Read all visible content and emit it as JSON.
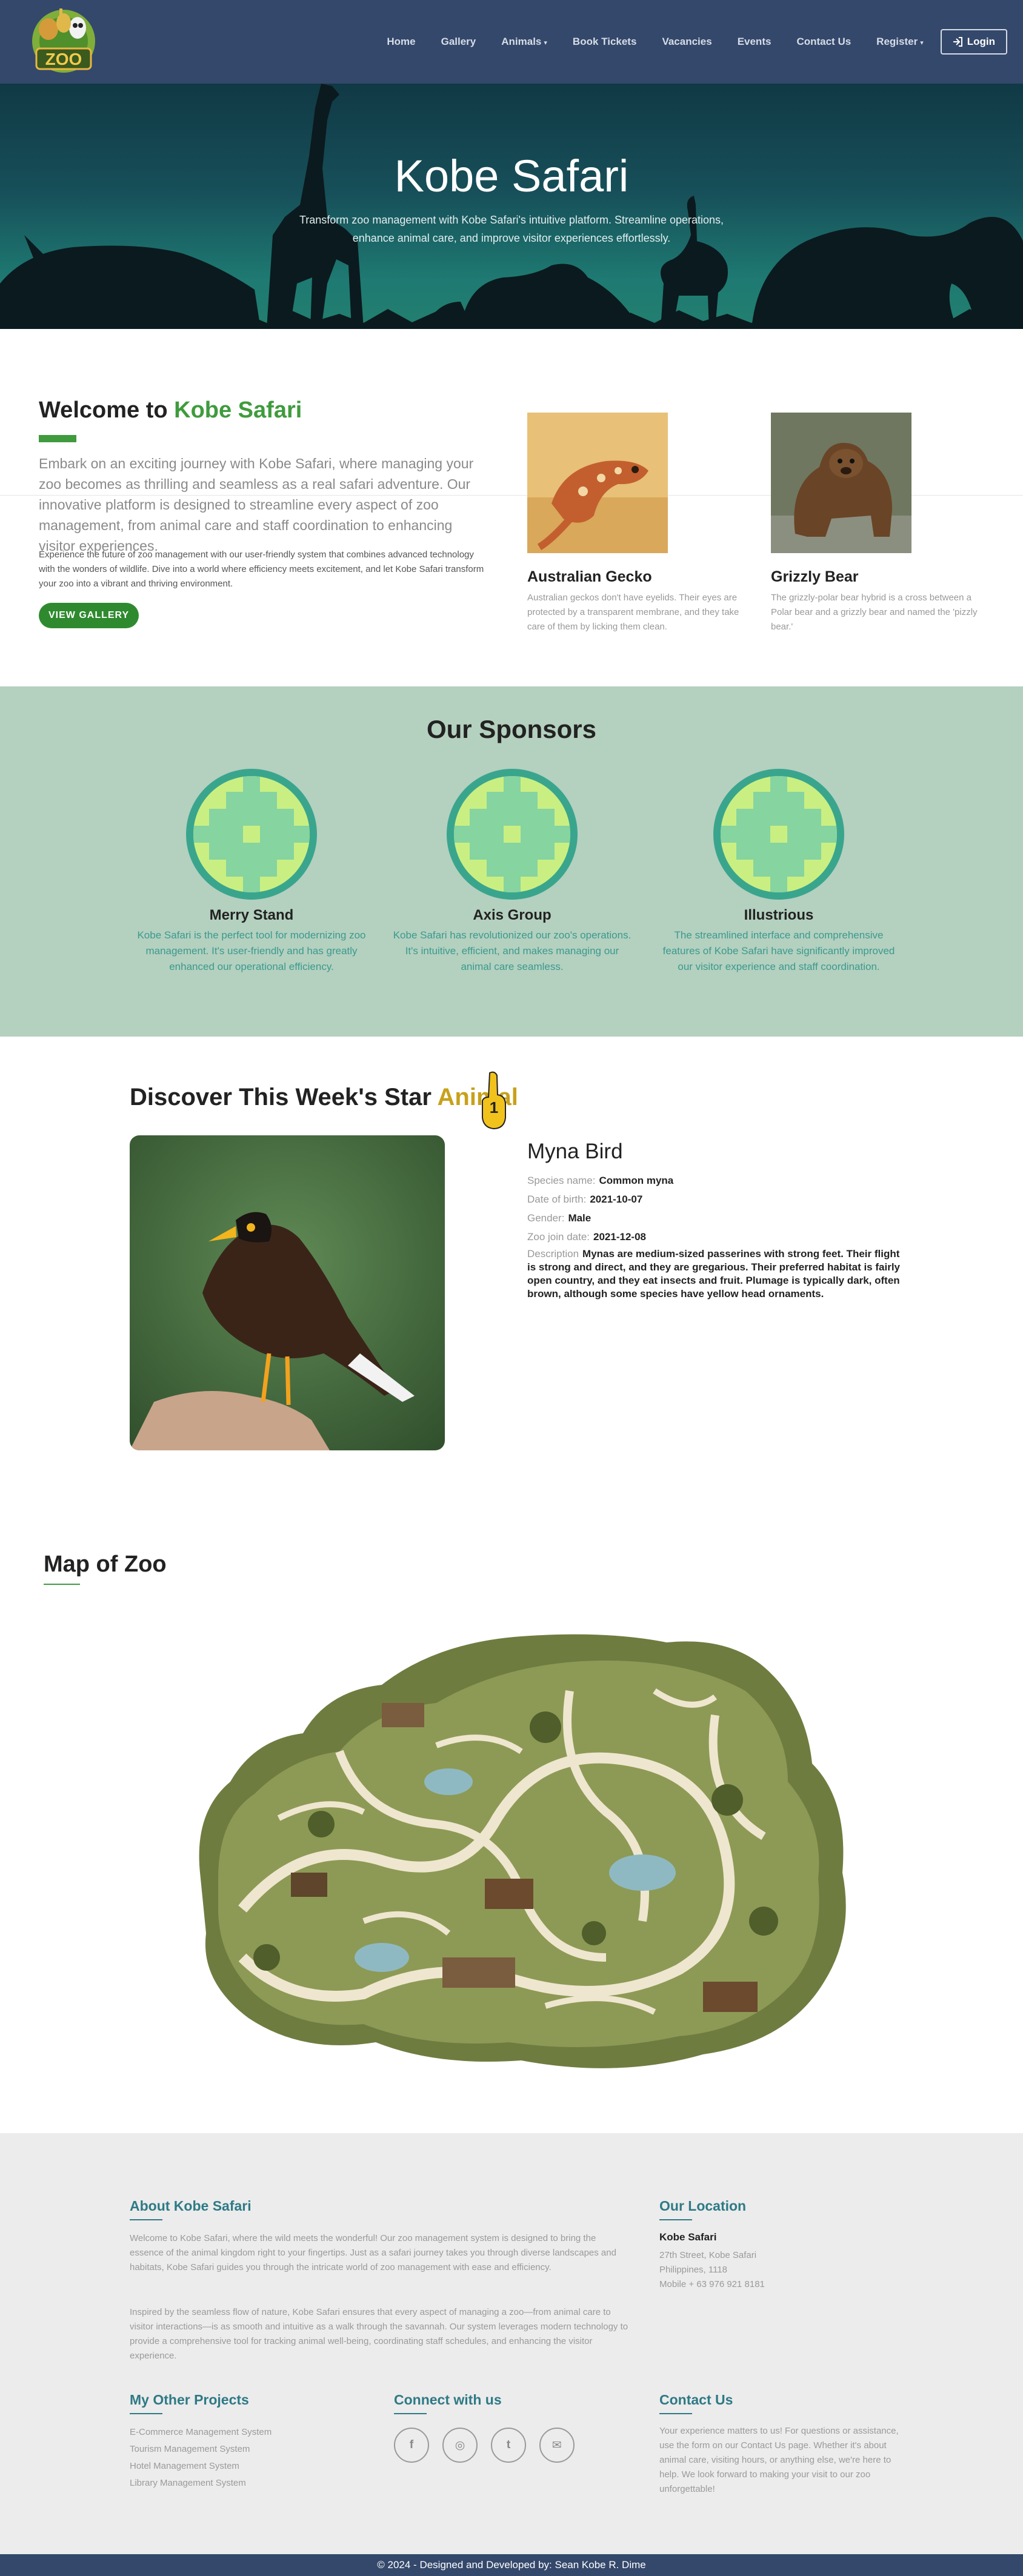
{
  "nav": {
    "logo_text": "ZOO",
    "links": [
      "Home",
      "Gallery",
      "Animals",
      "Book Tickets",
      "Vacancies",
      "Events",
      "Contact Us",
      "Register"
    ],
    "login": "Login"
  },
  "hero": {
    "title": "Kobe Safari",
    "subtitle": "Transform zoo management with Kobe Safari's intuitive platform. Streamline operations, enhance animal care, and improve visitor experiences effortlessly."
  },
  "welcome": {
    "title_prefix": "Welcome to ",
    "title_accent": "Kobe Safari",
    "lead": "Embark on an exciting journey with Kobe Safari, where managing your zoo becomes as thrilling and seamless as a real safari adventure. Our innovative platform is designed to streamline every aspect of zoo management, from animal care and staff coordination to enhancing visitor experiences.",
    "body": "Experience the future of zoo management with our user-friendly system that combines advanced technology with the wonders of wildlife. Dive into a world where efficiency meets excitement, and let Kobe Safari transform your zoo into a vibrant and thriving environment.",
    "button": "VIEW GALLERY",
    "animals": [
      {
        "name": "Australian Gecko",
        "desc": "Australian geckos don't have eyelids. Their eyes are protected by a transparent membrane, and they take care of them by licking them clean."
      },
      {
        "name": "Grizzly Bear",
        "desc": "The grizzly-polar bear hybrid is a cross between a Polar bear and a grizzly bear and named the 'pizzly bear.'"
      }
    ]
  },
  "sponsors": {
    "title": "Our Sponsors",
    "items": [
      {
        "name": "Merry Stand",
        "desc": "Kobe Safari is the perfect tool for modernizing zoo management. It's user-friendly and has greatly enhanced our operational efficiency."
      },
      {
        "name": "Axis Group",
        "desc": "Kobe Safari has revolutionized our zoo's operations. It's intuitive, efficient, and makes managing our animal care seamless."
      },
      {
        "name": "Illustrious",
        "desc": "The streamlined interface and comprehensive features of Kobe Safari have significantly improved our visitor experience and staff coordination."
      }
    ],
    "colors": {
      "ring": "#3aa58d",
      "light": "#c9ef82",
      "mid": "#86d4a0"
    }
  },
  "star": {
    "title_prefix": "Discover This Week's Star ",
    "title_accent": "Animal",
    "hand_label": "1",
    "name": "Myna Bird",
    "fields": [
      {
        "label": "Species name:",
        "value": "Common myna"
      },
      {
        "label": "Date of birth:",
        "value": "2021-10-07"
      },
      {
        "label": "Gender:",
        "value": "Male"
      },
      {
        "label": "Zoo join date:",
        "value": "2021-12-08"
      }
    ],
    "description_label": "Description",
    "description": "Mynas are medium-sized passerines with strong feet. Their flight is strong and direct, and they are gregarious. Their preferred habitat is fairly open country, and they eat insects and fruit. Plumage is typically dark, often brown, although some species have yellow head ornaments."
  },
  "map": {
    "title": "Map of Zoo"
  },
  "footer": {
    "about_title": "About Kobe Safari",
    "about_p1": "Welcome to Kobe Safari, where the wild meets the wonderful! Our zoo management system is designed to bring the essence of the animal kingdom right to your fingertips. Just as a safari journey takes you through diverse landscapes and habitats, Kobe Safari guides you through the intricate world of zoo management with ease and efficiency.",
    "about_p2": "Inspired by the seamless flow of nature, Kobe Safari ensures that every aspect of managing a zoo—from animal care to visitor interactions—is as smooth and intuitive as a walk through the savannah. Our system leverages modern technology to provide a comprehensive tool for tracking animal well-being, coordinating staff schedules, and enhancing the visitor experience.",
    "location_title": "Our Location",
    "location_name": "Kobe Safari",
    "location_lines": [
      "27th Street, Kobe Safari",
      "Philippines, 1118",
      "Mobile + 63 976 921 8181"
    ],
    "projects_title": "My Other Projects",
    "projects": [
      "E-Commerce Management System",
      "Tourism Management System",
      "Hotel Management System",
      "Library Management System"
    ],
    "connect_title": "Connect with us",
    "socials": [
      "f",
      "◎",
      "t",
      "✉"
    ],
    "contact_title": "Contact Us",
    "contact_text": "Your experience matters to us! For questions or assistance, use the form on our Contact Us page. Whether it's about animal care, visiting hours, or anything else, we're here to help. We look forward to making your visit to our zoo unforgettable!",
    "copyright": "© 2024 - Designed and Developed by: Sean Kobe R. Dime"
  }
}
